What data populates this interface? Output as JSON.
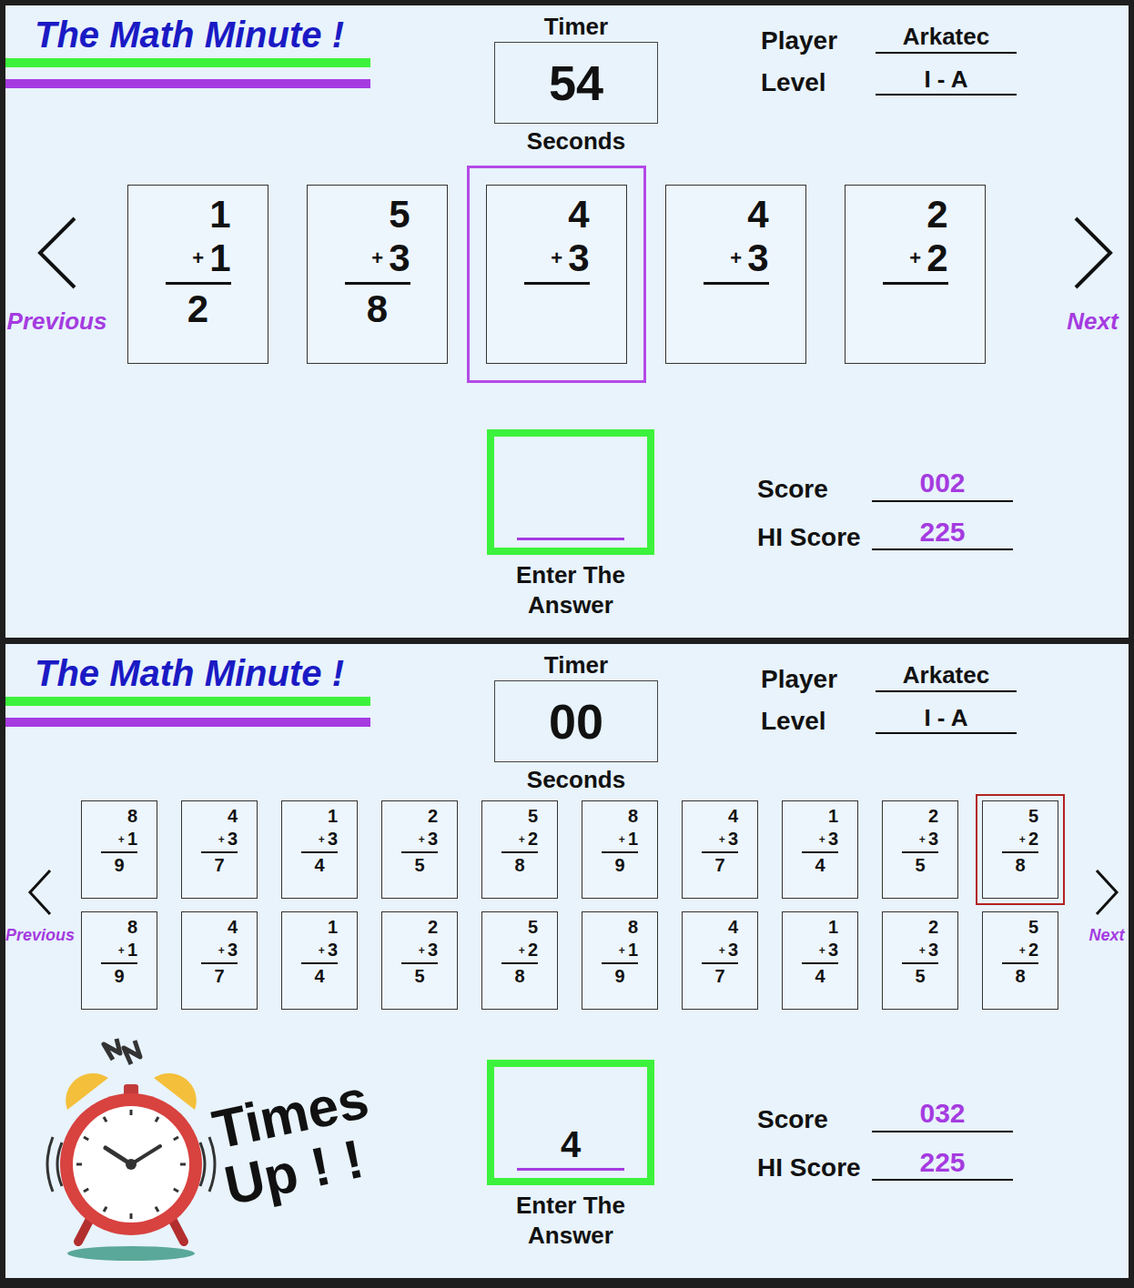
{
  "screens": [
    {
      "kind": "playing",
      "title": "The Math Minute !",
      "timer": {
        "label": "Timer",
        "value": "54",
        "unit": "Seconds"
      },
      "player": {
        "label": "Player",
        "value": "Arkatec"
      },
      "level": {
        "label": "Level",
        "value": "I - A"
      },
      "nav": {
        "previous": "Previous",
        "next": "Next"
      },
      "card_rows": [
        [
          {
            "top": "1",
            "operator": "+",
            "bottom": "1",
            "answer": "2",
            "selected": false
          },
          {
            "top": "5",
            "operator": "+",
            "bottom": "3",
            "answer": "8",
            "selected": false
          },
          {
            "top": "4",
            "operator": "+",
            "bottom": "3",
            "answer": "",
            "selected": true
          },
          {
            "top": "4",
            "operator": "+",
            "bottom": "3",
            "answer": "",
            "selected": false
          },
          {
            "top": "2",
            "operator": "+",
            "bottom": "2",
            "answer": "",
            "selected": false
          }
        ]
      ],
      "answer": {
        "value": "",
        "label": "Enter The Answer"
      },
      "score": {
        "label": "Score",
        "value": "002"
      },
      "hi_score": {
        "label": "HI Score",
        "value": "225"
      }
    },
    {
      "kind": "times-up",
      "title": "The Math Minute !",
      "timer": {
        "label": "Timer",
        "value": "00",
        "unit": "Seconds"
      },
      "player": {
        "label": "Player",
        "value": "Arkatec"
      },
      "level": {
        "label": "Level",
        "value": "I - A"
      },
      "nav": {
        "previous": "Previous",
        "next": "Next"
      },
      "card_rows": [
        [
          {
            "top": "8",
            "operator": "+",
            "bottom": "1",
            "answer": "9",
            "selected": false
          },
          {
            "top": "4",
            "operator": "+",
            "bottom": "3",
            "answer": "7",
            "selected": false
          },
          {
            "top": "1",
            "operator": "+",
            "bottom": "3",
            "answer": "4",
            "selected": false
          },
          {
            "top": "2",
            "operator": "+",
            "bottom": "3",
            "answer": "5",
            "selected": false
          },
          {
            "top": "5",
            "operator": "+",
            "bottom": "2",
            "answer": "8",
            "selected": false
          },
          {
            "top": "8",
            "operator": "+",
            "bottom": "1",
            "answer": "9",
            "selected": false
          },
          {
            "top": "4",
            "operator": "+",
            "bottom": "3",
            "answer": "7",
            "selected": false
          },
          {
            "top": "1",
            "operator": "+",
            "bottom": "3",
            "answer": "4",
            "selected": false
          },
          {
            "top": "2",
            "operator": "+",
            "bottom": "3",
            "answer": "5",
            "selected": false
          },
          {
            "top": "5",
            "operator": "+",
            "bottom": "2",
            "answer": "8",
            "selected": true
          }
        ],
        [
          {
            "top": "8",
            "operator": "+",
            "bottom": "1",
            "answer": "9",
            "selected": false
          },
          {
            "top": "4",
            "operator": "+",
            "bottom": "3",
            "answer": "7",
            "selected": false
          },
          {
            "top": "1",
            "operator": "+",
            "bottom": "3",
            "answer": "4",
            "selected": false
          },
          {
            "top": "2",
            "operator": "+",
            "bottom": "3",
            "answer": "5",
            "selected": false
          },
          {
            "top": "5",
            "operator": "+",
            "bottom": "2",
            "answer": "8",
            "selected": false
          },
          {
            "top": "8",
            "operator": "+",
            "bottom": "1",
            "answer": "9",
            "selected": false
          },
          {
            "top": "4",
            "operator": "+",
            "bottom": "3",
            "answer": "7",
            "selected": false
          },
          {
            "top": "1",
            "operator": "+",
            "bottom": "3",
            "answer": "4",
            "selected": false
          },
          {
            "top": "2",
            "operator": "+",
            "bottom": "3",
            "answer": "5",
            "selected": false
          },
          {
            "top": "5",
            "operator": "+",
            "bottom": "2",
            "answer": "8",
            "selected": false
          }
        ]
      ],
      "times_up": "Times Up ! !",
      "answer": {
        "value": "4",
        "label": "Enter The Answer"
      },
      "score": {
        "label": "Score",
        "value": "032"
      },
      "hi_score": {
        "label": "HI Score",
        "value": "225"
      }
    }
  ]
}
